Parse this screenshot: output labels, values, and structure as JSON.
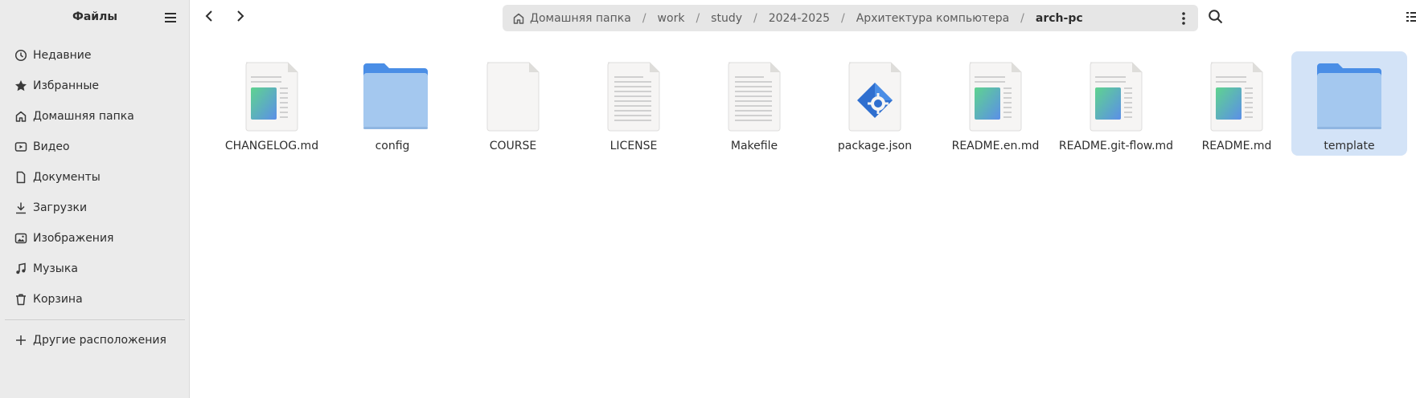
{
  "sidebar": {
    "title": "Файлы",
    "items": [
      {
        "label": "Недавние",
        "icon": "clock-icon"
      },
      {
        "label": "Избранные",
        "icon": "star-icon"
      },
      {
        "label": "Домашняя папка",
        "icon": "home-icon"
      },
      {
        "label": "Видео",
        "icon": "video-icon"
      },
      {
        "label": "Документы",
        "icon": "document-icon"
      },
      {
        "label": "Загрузки",
        "icon": "download-icon"
      },
      {
        "label": "Изображения",
        "icon": "image-icon"
      },
      {
        "label": "Музыка",
        "icon": "music-icon"
      },
      {
        "label": "Корзина",
        "icon": "trash-icon"
      }
    ],
    "other_locations": "Другие расположения"
  },
  "pathbar": {
    "crumbs": [
      "Домашняя папка",
      "work",
      "study",
      "2024-2025",
      "Архитектура компьютера",
      "arch-pc"
    ]
  },
  "files": [
    {
      "name": "CHANGELOG.md",
      "kind": "markdown"
    },
    {
      "name": "config",
      "kind": "folder"
    },
    {
      "name": "COURSE",
      "kind": "blank"
    },
    {
      "name": "LICENSE",
      "kind": "text"
    },
    {
      "name": "Makefile",
      "kind": "text"
    },
    {
      "name": "package.json",
      "kind": "json"
    },
    {
      "name": "README.en.md",
      "kind": "markdown"
    },
    {
      "name": "README.git-flow.md",
      "kind": "markdown"
    },
    {
      "name": "README.md",
      "kind": "markdown"
    },
    {
      "name": "template",
      "kind": "folder",
      "selected": true
    }
  ],
  "colors": {
    "sidebar_bg": "#ebebeb",
    "selection": "#d3e3f7",
    "folder": "#a4c8ef",
    "folder_tab": "#4a8ee6"
  }
}
